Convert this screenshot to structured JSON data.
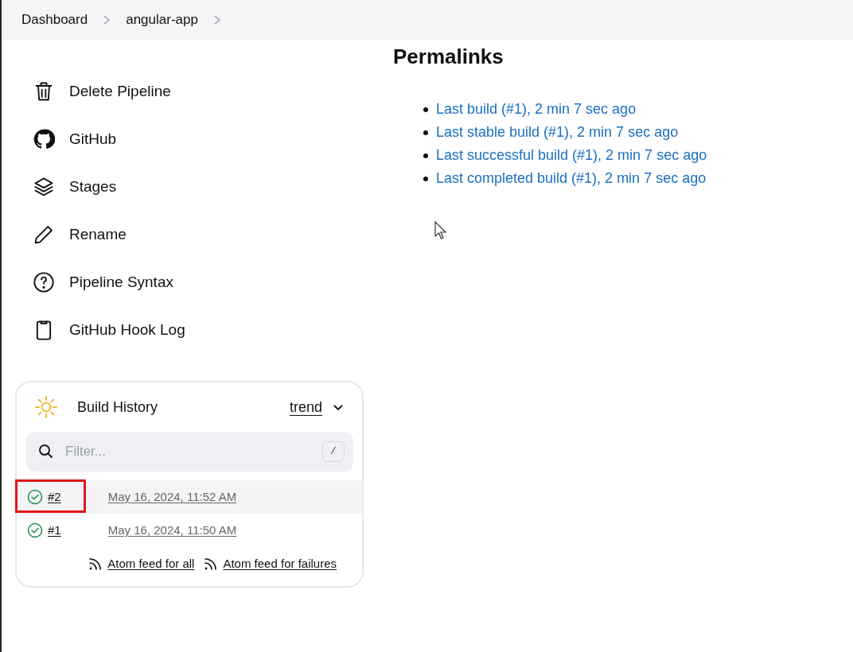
{
  "breadcrumbs": [
    "Dashboard",
    "angular-app"
  ],
  "sidebar": {
    "items": [
      {
        "kind": "trash",
        "label": "Delete Pipeline"
      },
      {
        "kind": "github",
        "label": "GitHub"
      },
      {
        "kind": "stages",
        "label": "Stages"
      },
      {
        "kind": "pencil",
        "label": "Rename"
      },
      {
        "kind": "help",
        "label": "Pipeline Syntax"
      },
      {
        "kind": "clipboard",
        "label": "GitHub Hook Log"
      }
    ]
  },
  "build_history": {
    "title": "Build History",
    "trend": "trend",
    "filter": {
      "placeholder": "Filter...",
      "shortcut": "/"
    },
    "builds": [
      {
        "number": "#2",
        "time": "May 16, 2024, 11:52 AM",
        "selected": true,
        "annotated": true
      },
      {
        "number": "#1",
        "time": "May 16, 2024, 11:50 AM",
        "selected": false,
        "annotated": false
      }
    ],
    "feeds": [
      "Atom feed for all",
      "Atom feed for failures"
    ]
  },
  "permalinks": {
    "title": "Permalinks",
    "links": [
      "Last build (#1), 2 min 7 sec ago",
      "Last stable build (#1), 2 min 7 sec ago",
      "Last successful build (#1), 2 min 7 sec ago",
      "Last completed build (#1), 2 min 7 sec ago"
    ]
  }
}
